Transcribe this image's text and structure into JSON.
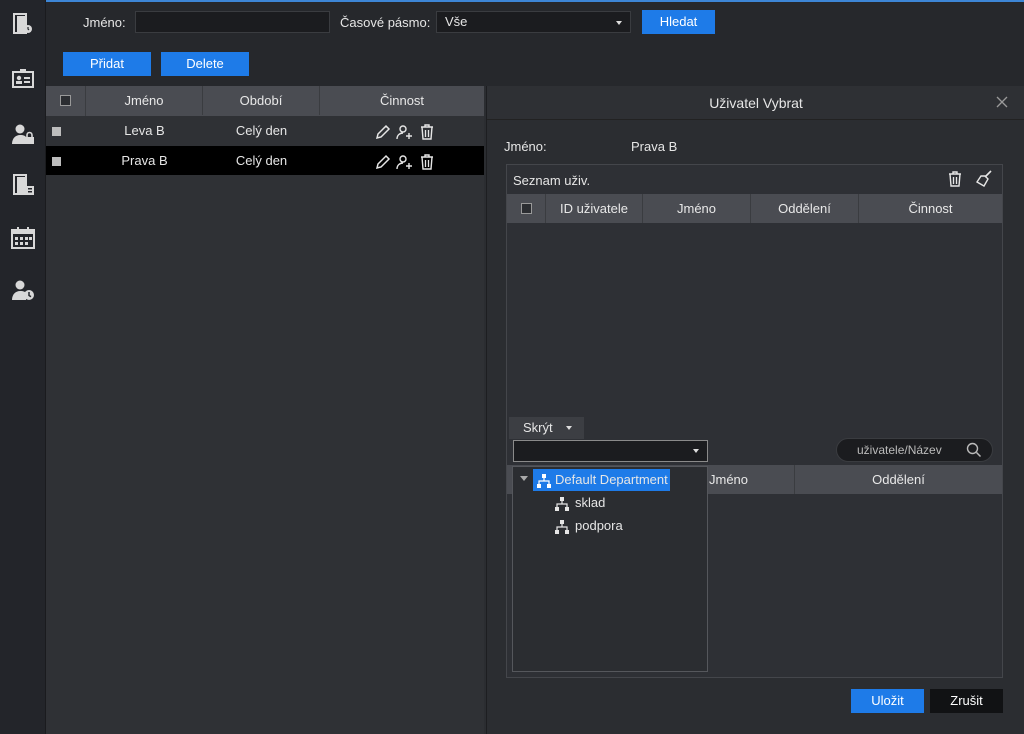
{
  "sidebar": {
    "icons": [
      "door-access-icon",
      "id-card-icon",
      "user-lock-icon",
      "door-log-icon",
      "calendar-icon",
      "user-clock-icon"
    ]
  },
  "toolbar": {
    "name_label": "Jméno:",
    "name_value": "",
    "timezone_label": "Časové pásmo:",
    "timezone_value": "Vše",
    "search_button": "Hledat",
    "add_button": "Přidat",
    "delete_button": "Delete"
  },
  "list": {
    "columns": [
      "Jméno",
      "Období",
      "Činnost"
    ],
    "rows": [
      {
        "name": "Leva B",
        "period": "Celý den"
      },
      {
        "name": "Prava B",
        "period": "Celý den"
      }
    ]
  },
  "dialog": {
    "title": "Uživatel Vybrat",
    "name_label": "Jméno:",
    "name_value": "Prava B",
    "user_list_title": "Seznam uživ.",
    "user_columns": [
      "ID uživatele",
      "Jméno",
      "Oddělení",
      "Činnost"
    ],
    "hide_tab": "Skrýt",
    "department_value": "",
    "search_placeholder": "uživatele/Název",
    "lower_columns": [
      "Jméno",
      "Oddělení"
    ],
    "tree": {
      "root": "Default Department",
      "children": [
        "sklad",
        "podpora"
      ]
    },
    "ok_button": "Uložit",
    "cancel_button": "Zrušit"
  },
  "colors": {
    "accent": "#1e7be8",
    "selected_row": "#000000"
  }
}
